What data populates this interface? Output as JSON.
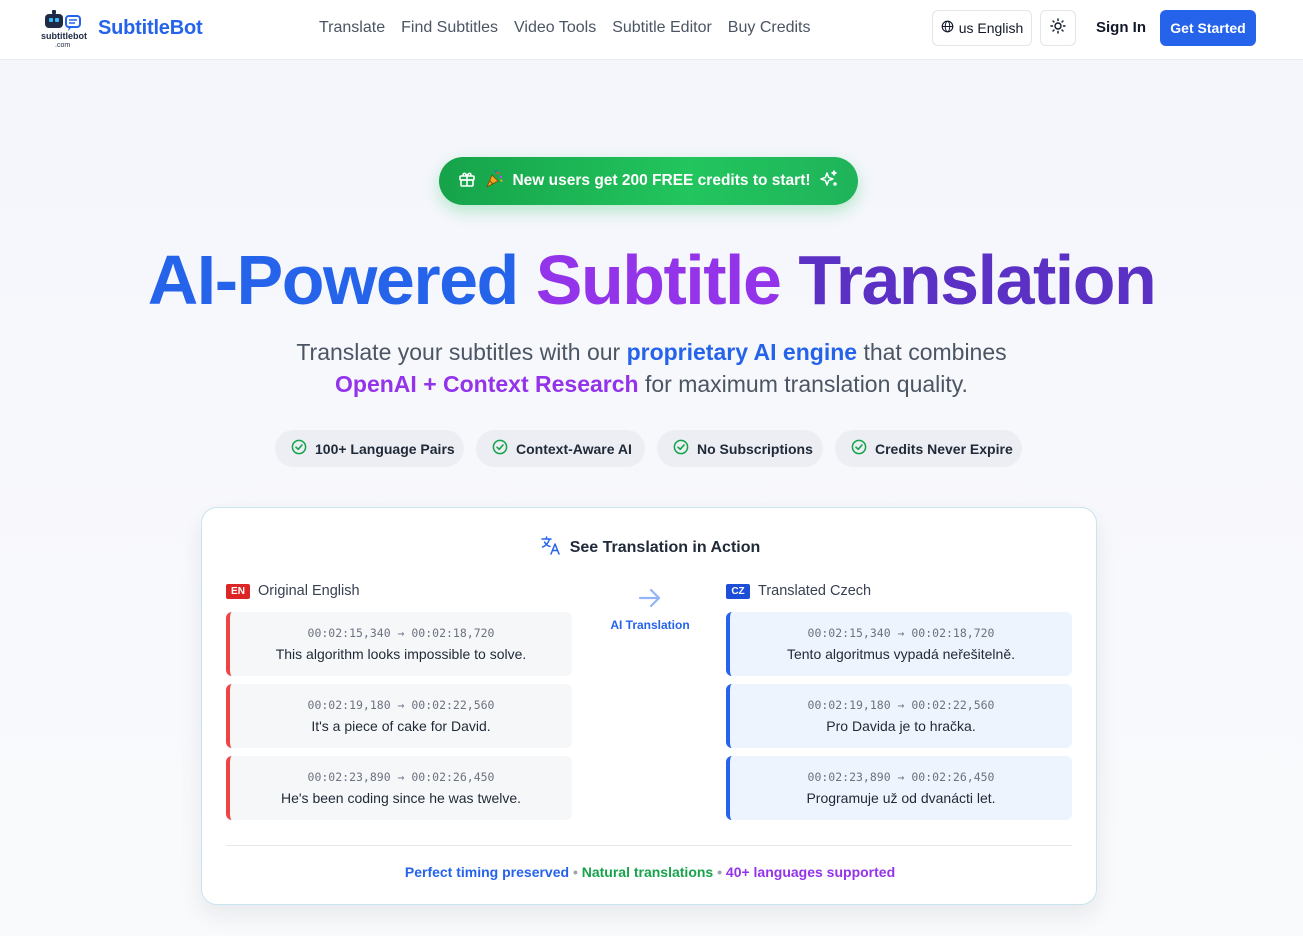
{
  "nav": {
    "logo_text": "subtitlebot",
    "logo_sub": ".com",
    "brand": "SubtitleBot",
    "links": [
      "Translate",
      "Find Subtitles",
      "Video Tools",
      "Subtitle Editor",
      "Buy Credits"
    ],
    "language": "us English",
    "sign_in": "Sign In",
    "get_started": "Get Started"
  },
  "promo": {
    "text": "New users get 200 FREE credits to start!"
  },
  "hero": {
    "title_part1": "AI-Powered",
    "title_part2": "Subtitle",
    "title_part3": "Translation",
    "sub_a": "Translate your subtitles with our",
    "sub_b": "proprietary AI engine",
    "sub_c": "that combines",
    "sub_d": "OpenAI + Context Research",
    "sub_e": "for maximum translation quality."
  },
  "features": [
    "100+ Language Pairs",
    "Context-Aware AI",
    "No Subscriptions",
    "Credits Never Expire"
  ],
  "demo": {
    "heading": "See Translation in Action",
    "original_flag": "EN",
    "original_label": "Original English",
    "translated_flag": "CZ",
    "translated_label": "Translated Czech",
    "middle_label": "AI Translation",
    "original": [
      {
        "time": "00:02:15,340 → 00:02:18,720",
        "text": "This algorithm looks impossible to solve."
      },
      {
        "time": "00:02:19,180 → 00:02:22,560",
        "text": "It's a piece of cake for David."
      },
      {
        "time": "00:02:23,890 → 00:02:26,450",
        "text": "He's been coding since he was twelve."
      }
    ],
    "translated": [
      {
        "time": "00:02:15,340 → 00:02:18,720",
        "text": "Tento algoritmus vypadá neřešitelně."
      },
      {
        "time": "00:02:19,180 → 00:02:22,560",
        "text": "Pro Davida je to hračka."
      },
      {
        "time": "00:02:23,890 → 00:02:26,450",
        "text": "Programuje už od dvanácti let."
      }
    ],
    "footer": {
      "part1": "Perfect timing preserved",
      "sep": "•",
      "part2": "Natural translations",
      "part3": "40+ languages supported"
    }
  },
  "colors": {
    "accent_blue": "#2563eb",
    "accent_purple": "#9333ea",
    "promo_green": "#22c55e",
    "check_green": "#16a34a",
    "original_red": "#ef4444"
  }
}
